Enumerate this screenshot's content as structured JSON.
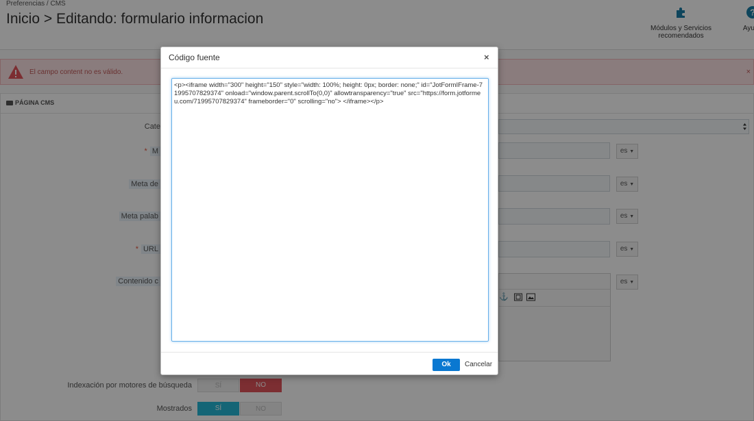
{
  "header": {
    "breadcrumb": "Preferencias  /  CMS",
    "title": "Inicio > Editando: formulario informacion",
    "toolbar": {
      "modules_label": "Módulos y Servicios recomendados",
      "help_label": "Ayuda"
    }
  },
  "alert": {
    "message": "El campo content no es válido.",
    "close": "×"
  },
  "panel": {
    "title": "PÁGINA CMS",
    "fields": {
      "category_label": "Cate",
      "meta_title_label": "M",
      "meta_description_label": "Meta de",
      "meta_keywords_label": "Meta palab",
      "url_label": "URL",
      "content_label": "Contenido c",
      "indexation_label": "Indexación por motores de búsqueda",
      "shown_label": "Mostrados"
    },
    "lang": "es",
    "toggle_yes": "SÍ",
    "toggle_no": "NO",
    "indexation_value": "NO",
    "shown_value": "SÍ"
  },
  "modal": {
    "title": "Código fuente",
    "close": "×",
    "code": "<p><iframe width=\"300\" height=\"150\" style=\"width: 100%; height: 0px; border: none;\" id=\"JotFormIFrame-71995707829374\" onload=\"window.parent.scrollTo(0,0)\" allowtransparency=\"true\" src=\"https://form.jotformeu.com/71995707829374\" frameborder=\"0\" scrolling=\"no\"> </iframe></p>",
    "ok_label": "Ok",
    "cancel_label": "Cancelar"
  },
  "colors": {
    "accent": "#0a78d1",
    "toggle_on": "#25b9d7",
    "toggle_no_on": "#e2555b",
    "alert_bg": "#fbe2e3"
  }
}
